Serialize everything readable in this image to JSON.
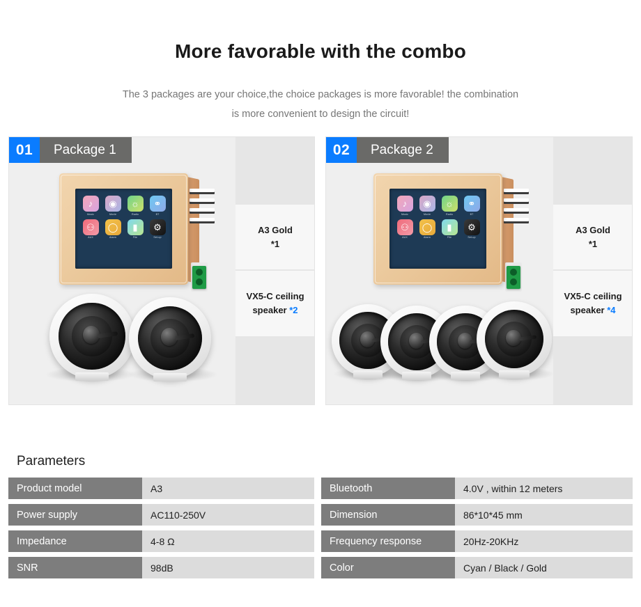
{
  "header": {
    "title": "More favorable with the combo",
    "subtitle_line1": "The 3 packages are your choice,the choice packages is more favorable! the combination",
    "subtitle_line2": "is more convenient to design the circuit!"
  },
  "accent_colors": {
    "badge_blue": "#0a7cff",
    "badge_gray": "#6a6a68",
    "table_key_gray": "#7d7d7d",
    "table_value_gray": "#dcdcdc",
    "card_bg": "#efefef"
  },
  "packages": [
    {
      "number": "01",
      "name": "Package 1",
      "specs": [
        {
          "label": "A3 Gold",
          "qty": "*1"
        },
        {
          "label": "VX5-C ceiling speaker",
          "qty": "*2"
        }
      ],
      "speaker_count": 2
    },
    {
      "number": "02",
      "name": "Package 2",
      "specs": [
        {
          "label": "A3 Gold",
          "qty": "*1"
        },
        {
          "label": "VX5-C ceiling speaker",
          "qty": "*4"
        }
      ],
      "speaker_count": 4
    }
  ],
  "device_screen": {
    "apps": [
      {
        "label": "Music",
        "icon": "music-note-icon"
      },
      {
        "label": "Movie",
        "icon": "film-reel-icon"
      },
      {
        "label": "Radio",
        "icon": "radio-icon"
      },
      {
        "label": "BT",
        "icon": "bluetooth-icon"
      },
      {
        "label": "AUX",
        "icon": "aux-plug-icon"
      },
      {
        "label": "Alarm",
        "icon": "clock-icon"
      },
      {
        "label": "File",
        "icon": "folder-icon"
      },
      {
        "label": "Set-up",
        "icon": "gear-icon"
      }
    ]
  },
  "parameters": {
    "title": "Parameters",
    "left": [
      {
        "key": "Product model",
        "value": "A3"
      },
      {
        "key": "Power supply",
        "value": "AC110-250V"
      },
      {
        "key": "Impedance",
        "value": "4-8 Ω"
      },
      {
        "key": "SNR",
        "value": "98dB"
      }
    ],
    "right": [
      {
        "key": "Bluetooth",
        "value": "4.0V , within 12 meters"
      },
      {
        "key": "Dimension",
        "value": "86*10*45 mm"
      },
      {
        "key": "Frequency response",
        "value": "20Hz-20KHz"
      },
      {
        "key": "Color",
        "value": "Cyan / Black / Gold"
      }
    ]
  }
}
